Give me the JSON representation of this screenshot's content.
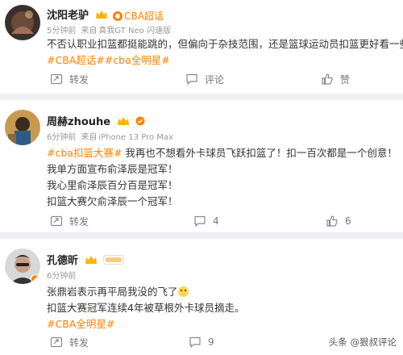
{
  "colors": {
    "accent": "#ff8200",
    "hashtag": "#ff8200",
    "meta": "#999999",
    "background": "#eef0f3"
  },
  "posts": [
    {
      "username": "沈阳老驴",
      "tag": "CBA超话",
      "time": "5分钟前",
      "source_prefix": "来自",
      "device": "真我GT Neo 闪速版",
      "lines": [
        [
          {
            "t": "不否认职业扣篮都挺能跳的，但偏向于杂技范围，还是篮球运动员扣篮更好看一些",
            "h": false
          }
        ],
        [
          {
            "t": "#CBA超话##cba全明星#",
            "h": true
          }
        ]
      ],
      "repost_label": "转发",
      "comment_label": "评论",
      "like_label": "赞"
    },
    {
      "username": "周赫zhouhe",
      "time": "6分钟前",
      "source_prefix": "来自",
      "device": "iPhone 13 Pro Max",
      "lines": [
        [
          {
            "t": "#cba扣篮大赛#",
            "h": true
          },
          {
            "t": " 我再也不想看外卡球员飞跃扣篮了！扣一百次都是一个创意！",
            "h": false
          }
        ],
        [
          {
            "t": "我单方面宣布俞泽辰是冠军！",
            "h": false
          }
        ],
        [
          {
            "t": "我心里俞泽辰百分百是冠军！",
            "h": false
          }
        ],
        [
          {
            "t": "扣篮大赛欠俞泽辰一个冠军！",
            "h": false
          }
        ]
      ],
      "repost_label": "转发",
      "comment_count": "4",
      "like_count": "6"
    },
    {
      "username": "孔德昕",
      "time": "6分钟前",
      "lines": [
        [
          {
            "t": "张鼎岩表示再平局我没的飞了",
            "h": false
          }
        ],
        [
          {
            "t": "扣篮大赛冠军连续4年被草根外卡球员摘走。",
            "h": false
          }
        ],
        [
          {
            "t": "#CBA全明星#",
            "h": true
          }
        ]
      ],
      "repost_label": "转发",
      "comment_count": "9"
    }
  ],
  "watermark": "头条 @狠叔评论",
  "icons": [
    "repost-icon",
    "comment-icon",
    "like-icon",
    "vip-crown-icon",
    "verified-badge-icon",
    "super-topic-icon",
    "emoji-icon"
  ]
}
